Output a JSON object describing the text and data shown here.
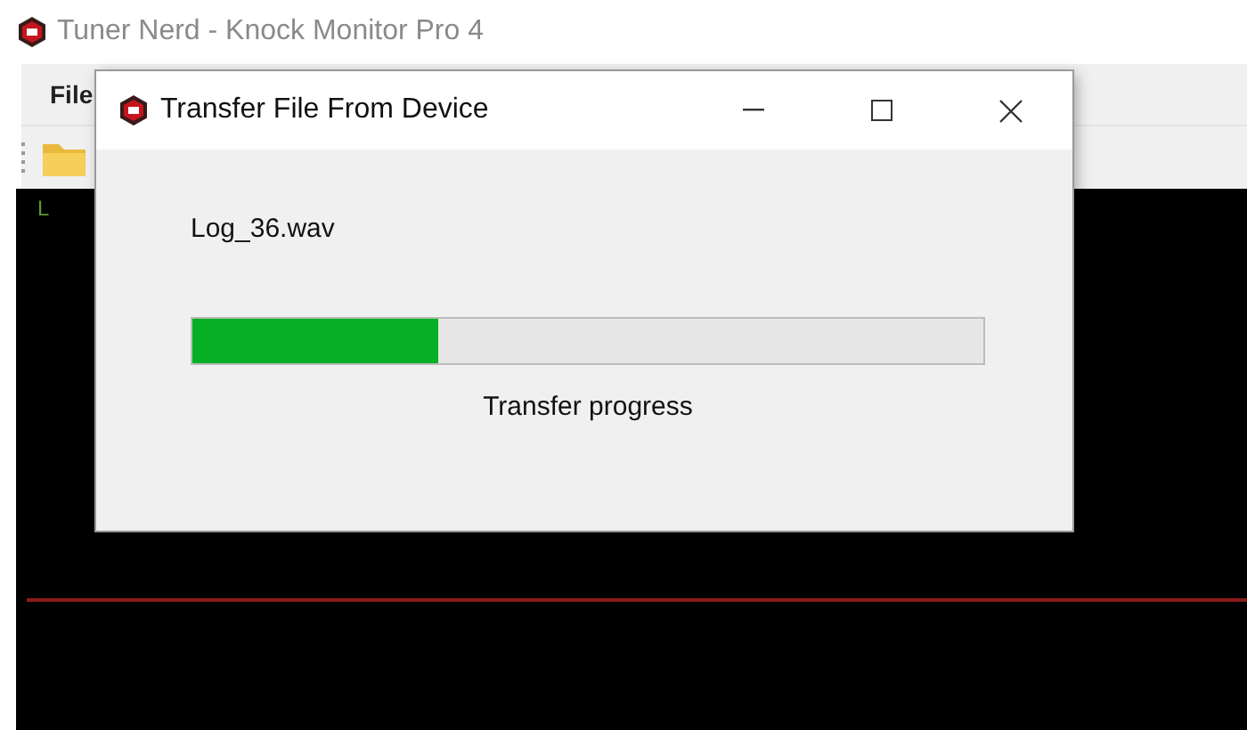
{
  "window": {
    "title": "Tuner Nerd - Knock Monitor Pro 4"
  },
  "menu": [
    {
      "label": "File"
    }
  ],
  "plot": {
    "channel_label": "L"
  },
  "dialog": {
    "title": "Transfer File From Device",
    "file_name": "Log_36.wav",
    "progress": {
      "level": 0.31,
      "caption": "Transfer progress"
    }
  }
}
